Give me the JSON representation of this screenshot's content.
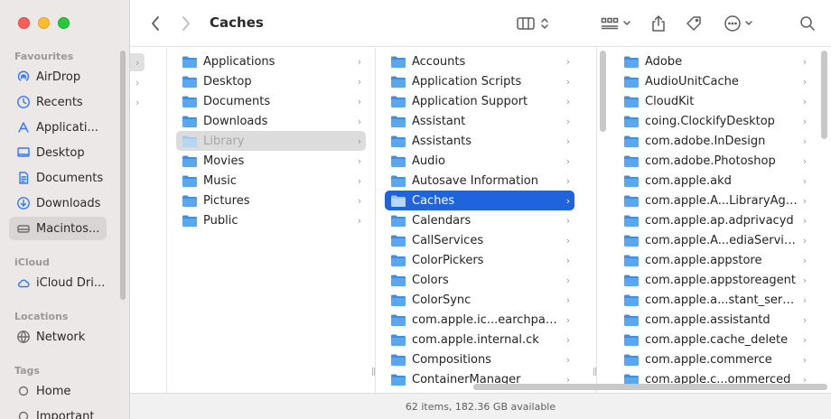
{
  "window": {
    "title": "Caches"
  },
  "colors": {
    "accent": "#1f64dd",
    "folder": "#5aa7ef",
    "sidebar_icon": "#3478f6"
  },
  "sidebar": {
    "favourites_heading": "Favourites",
    "favourites": [
      {
        "label": "AirDrop",
        "icon": "airdrop-icon"
      },
      {
        "label": "Recents",
        "icon": "clock-icon"
      },
      {
        "label": "Applicati...",
        "icon": "applications-icon"
      },
      {
        "label": "Desktop",
        "icon": "desktop-icon"
      },
      {
        "label": "Documents",
        "icon": "document-icon"
      },
      {
        "label": "Downloads",
        "icon": "download-icon"
      },
      {
        "label": "Macintos...",
        "icon": "hard-drive-icon",
        "selected": true
      }
    ],
    "icloud_heading": "iCloud",
    "icloud": [
      {
        "label": "iCloud Dri...",
        "icon": "cloud-icon"
      }
    ],
    "locations_heading": "Locations",
    "locations": [
      {
        "label": "Network",
        "icon": "globe-icon"
      }
    ],
    "tags_heading": "Tags",
    "tags": [
      {
        "label": "Home",
        "icon": "tag-circle-icon"
      },
      {
        "label": "Important",
        "icon": "tag-circle-icon"
      }
    ]
  },
  "columns": {
    "home": [
      {
        "label": "Applications"
      },
      {
        "label": "Desktop"
      },
      {
        "label": "Documents"
      },
      {
        "label": "Downloads"
      },
      {
        "label": "Library",
        "state": "inactive"
      },
      {
        "label": "Movies"
      },
      {
        "label": "Music"
      },
      {
        "label": "Pictures"
      },
      {
        "label": "Public"
      }
    ],
    "library": [
      {
        "label": "Accounts"
      },
      {
        "label": "Application Scripts"
      },
      {
        "label": "Application Support"
      },
      {
        "label": "Assistant"
      },
      {
        "label": "Assistants"
      },
      {
        "label": "Audio"
      },
      {
        "label": "Autosave Information"
      },
      {
        "label": "Caches",
        "state": "selected"
      },
      {
        "label": "Calendars"
      },
      {
        "label": "CallServices"
      },
      {
        "label": "ColorPickers"
      },
      {
        "label": "Colors"
      },
      {
        "label": "ColorSync"
      },
      {
        "label": "com.apple.ic...earchpartyd"
      },
      {
        "label": "com.apple.internal.ck"
      },
      {
        "label": "Compositions"
      },
      {
        "label": "ContainerManager"
      }
    ],
    "caches": [
      {
        "label": "Adobe"
      },
      {
        "label": "AudioUnitCache"
      },
      {
        "label": "CloudKit"
      },
      {
        "label": "coing.ClockifyDesktop"
      },
      {
        "label": "com.adobe.InDesign"
      },
      {
        "label": "com.adobe.Photoshop"
      },
      {
        "label": "com.apple.akd"
      },
      {
        "label": "com.apple.A...LibraryAgent"
      },
      {
        "label": "com.apple.ap.adprivacyd"
      },
      {
        "label": "com.apple.A...ediaServices"
      },
      {
        "label": "com.apple.appstore"
      },
      {
        "label": "com.apple.appstoreagent"
      },
      {
        "label": "com.apple.a...stant_service"
      },
      {
        "label": "com.apple.assistantd"
      },
      {
        "label": "com.apple.cache_delete"
      },
      {
        "label": "com.apple.commerce"
      },
      {
        "label": "com.apple.c...ommerced"
      }
    ]
  },
  "status": {
    "text": "62 items, 182.36 GB available"
  }
}
